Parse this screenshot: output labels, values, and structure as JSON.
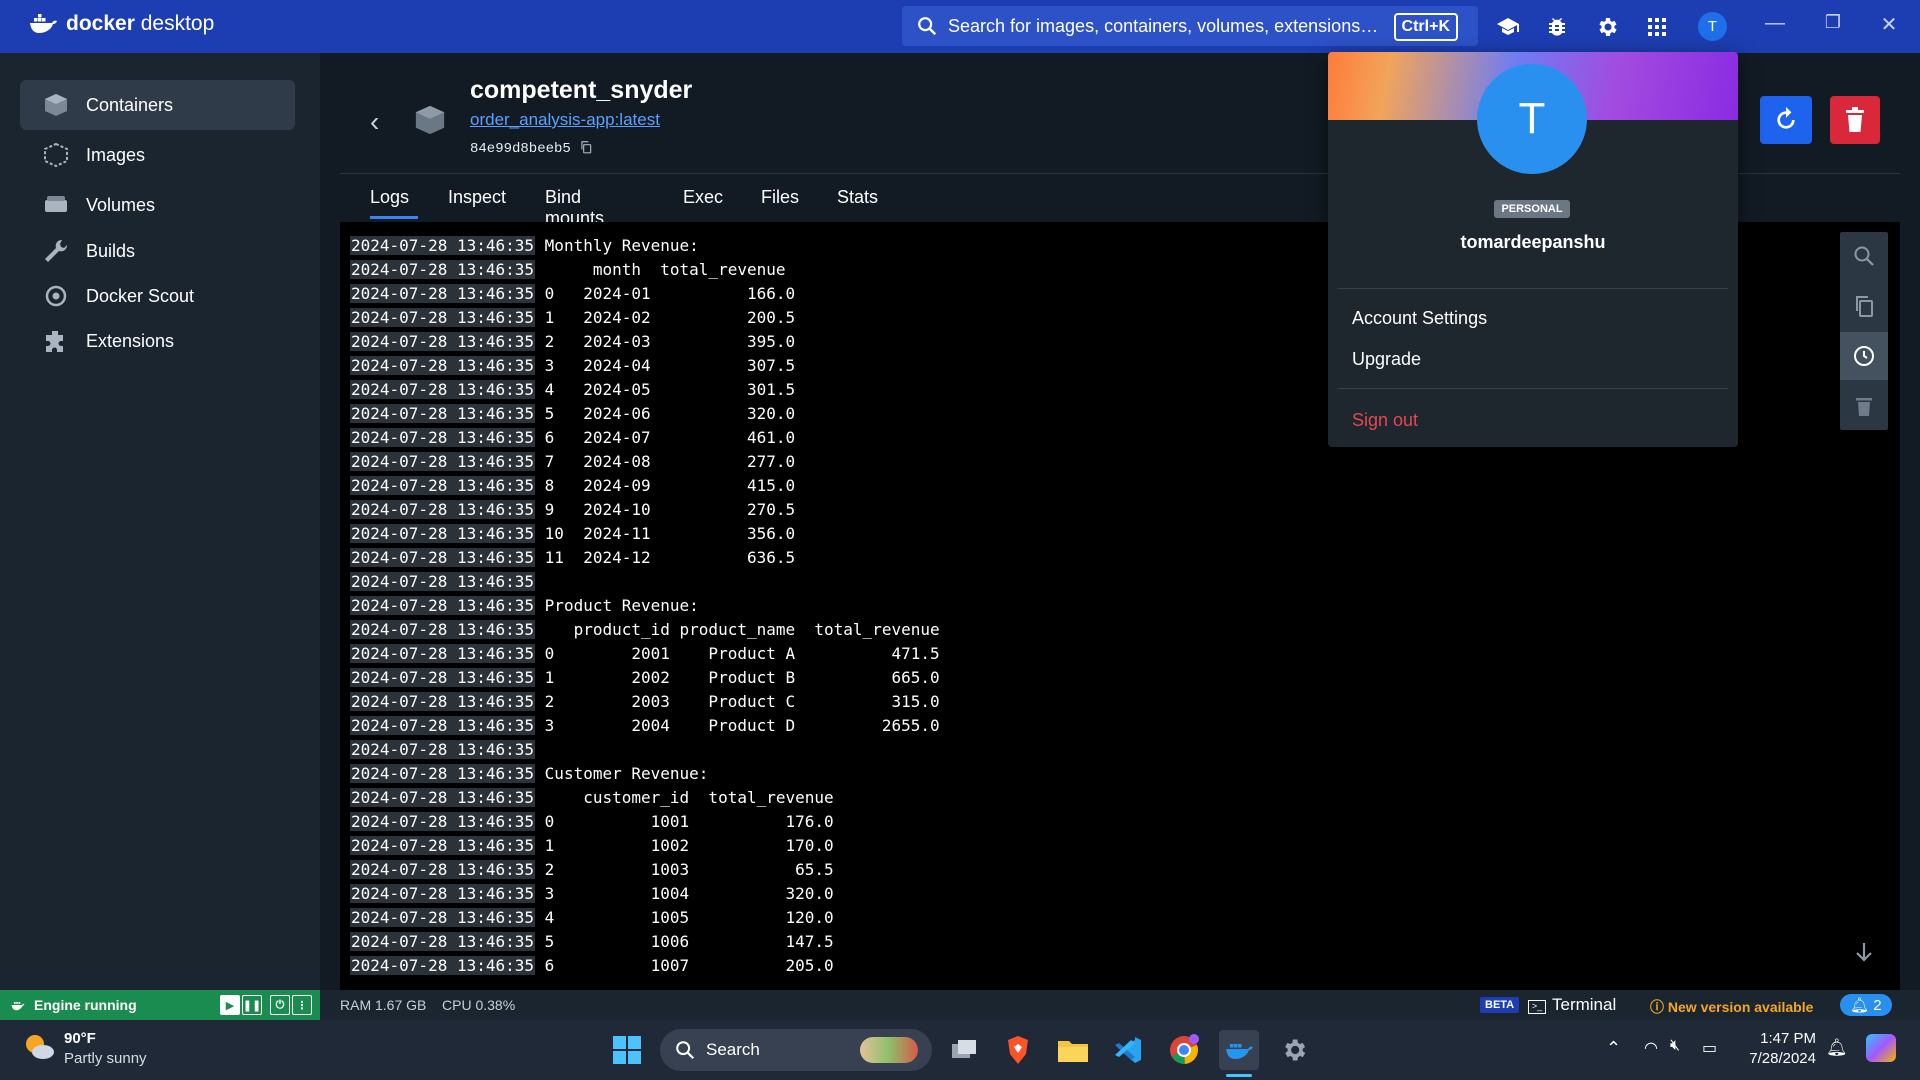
{
  "topbar": {
    "logo_text_bold": "docker",
    "logo_text": "desktop",
    "search_placeholder": "Search for images, containers, volumes, extensions…",
    "shortcut": "Ctrl+K",
    "avatar_initial": "T"
  },
  "sidebar": {
    "items": [
      {
        "label": "Containers",
        "icon": "containers-icon"
      },
      {
        "label": "Images",
        "icon": "images-icon"
      },
      {
        "label": "Volumes",
        "icon": "volumes-icon"
      },
      {
        "label": "Builds",
        "icon": "builds-icon"
      },
      {
        "label": "Docker Scout",
        "icon": "docker-scout-icon"
      },
      {
        "label": "Extensions",
        "icon": "extensions-icon"
      }
    ],
    "engine_status": "Engine running"
  },
  "container": {
    "name": "competent_snyder",
    "image_link": "order_analysis-app:latest",
    "id": "84e99d8beeb5"
  },
  "tabs": [
    "Logs",
    "Inspect",
    "Bind mounts",
    "Exec",
    "Files",
    "Stats"
  ],
  "logs": [
    {
      "ts": "2024-07-28 13:46:35",
      "text": "Monthly Revenue:"
    },
    {
      "ts": "2024-07-28 13:46:35",
      "text": "     month  total_revenue"
    },
    {
      "ts": "2024-07-28 13:46:35",
      "text": "0   2024-01          166.0"
    },
    {
      "ts": "2024-07-28 13:46:35",
      "text": "1   2024-02          200.5"
    },
    {
      "ts": "2024-07-28 13:46:35",
      "text": "2   2024-03          395.0"
    },
    {
      "ts": "2024-07-28 13:46:35",
      "text": "3   2024-04          307.5"
    },
    {
      "ts": "2024-07-28 13:46:35",
      "text": "4   2024-05          301.5"
    },
    {
      "ts": "2024-07-28 13:46:35",
      "text": "5   2024-06          320.0"
    },
    {
      "ts": "2024-07-28 13:46:35",
      "text": "6   2024-07          461.0"
    },
    {
      "ts": "2024-07-28 13:46:35",
      "text": "7   2024-08          277.0"
    },
    {
      "ts": "2024-07-28 13:46:35",
      "text": "8   2024-09          415.0"
    },
    {
      "ts": "2024-07-28 13:46:35",
      "text": "9   2024-10          270.5"
    },
    {
      "ts": "2024-07-28 13:46:35",
      "text": "10  2024-11          356.0"
    },
    {
      "ts": "2024-07-28 13:46:35",
      "text": "11  2024-12          636.5"
    },
    {
      "ts": "2024-07-28 13:46:35",
      "text": ""
    },
    {
      "ts": "2024-07-28 13:46:35",
      "text": "Product Revenue:"
    },
    {
      "ts": "2024-07-28 13:46:35",
      "text": "   product_id product_name  total_revenue"
    },
    {
      "ts": "2024-07-28 13:46:35",
      "text": "0        2001    Product A          471.5"
    },
    {
      "ts": "2024-07-28 13:46:35",
      "text": "1        2002    Product B          665.0"
    },
    {
      "ts": "2024-07-28 13:46:35",
      "text": "2        2003    Product C          315.0"
    },
    {
      "ts": "2024-07-28 13:46:35",
      "text": "3        2004    Product D         2655.0"
    },
    {
      "ts": "2024-07-28 13:46:35",
      "text": ""
    },
    {
      "ts": "2024-07-28 13:46:35",
      "text": "Customer Revenue:"
    },
    {
      "ts": "2024-07-28 13:46:35",
      "text": "    customer_id  total_revenue"
    },
    {
      "ts": "2024-07-28 13:46:35",
      "text": "0          1001          176.0"
    },
    {
      "ts": "2024-07-28 13:46:35",
      "text": "1          1002          170.0"
    },
    {
      "ts": "2024-07-28 13:46:35",
      "text": "2          1003           65.5"
    },
    {
      "ts": "2024-07-28 13:46:35",
      "text": "3          1004          320.0"
    },
    {
      "ts": "2024-07-28 13:46:35",
      "text": "4          1005          120.0"
    },
    {
      "ts": "2024-07-28 13:46:35",
      "text": "5          1006          147.5"
    },
    {
      "ts": "2024-07-28 13:46:35",
      "text": "6          1007          205.0"
    }
  ],
  "account_menu": {
    "avatar_initial": "T",
    "badge": "PERSONAL",
    "username": "tomardeepanshu",
    "items": [
      "Account Settings",
      "Upgrade"
    ],
    "sign_out": "Sign out"
  },
  "statusbar": {
    "ram": "RAM 1.67 GB",
    "cpu": "CPU 0.38%",
    "beta": "BETA",
    "terminal": "Terminal",
    "new_version": "New version available",
    "notifications": "2"
  },
  "taskbar": {
    "weather_temp": "90°F",
    "weather_desc": "Partly sunny",
    "search": "Search",
    "time": "1:47 PM",
    "date": "7/28/2024"
  },
  "colors": {
    "topbar": "#1d3eb3",
    "accent": "#1d63ed",
    "danger": "#d8283a",
    "engine": "#1a8c4f"
  }
}
